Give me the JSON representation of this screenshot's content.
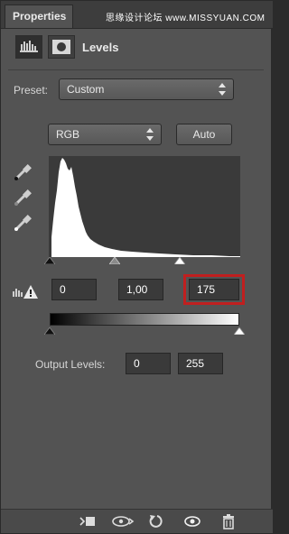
{
  "panel": {
    "tab_label": "Properties",
    "watermark": "思缘设计论坛 www.MISSYUAN.COM",
    "title": "Levels"
  },
  "preset": {
    "label": "Preset:",
    "value": "Custom"
  },
  "channel": {
    "value": "RGB"
  },
  "auto_button": "Auto",
  "input_levels": {
    "black": "0",
    "gamma": "1,00",
    "white": "175"
  },
  "output_levels": {
    "label": "Output Levels:",
    "black": "0",
    "white": "255"
  },
  "icons": {
    "histogram_icon": "histogram-icon",
    "mask_icon": "mask-icon",
    "eyedroppers": [
      "black-eyedropper-icon",
      "gray-eyedropper-icon",
      "white-eyedropper-icon"
    ],
    "warning": "clipping-warning-icon",
    "footer": [
      "clip-to-layer-icon",
      "view-previous-state-icon",
      "reset-icon",
      "visibility-eye-icon",
      "trash-icon"
    ]
  },
  "colors": {
    "panel_bg": "#535353",
    "highlight": "#c01f1f"
  }
}
